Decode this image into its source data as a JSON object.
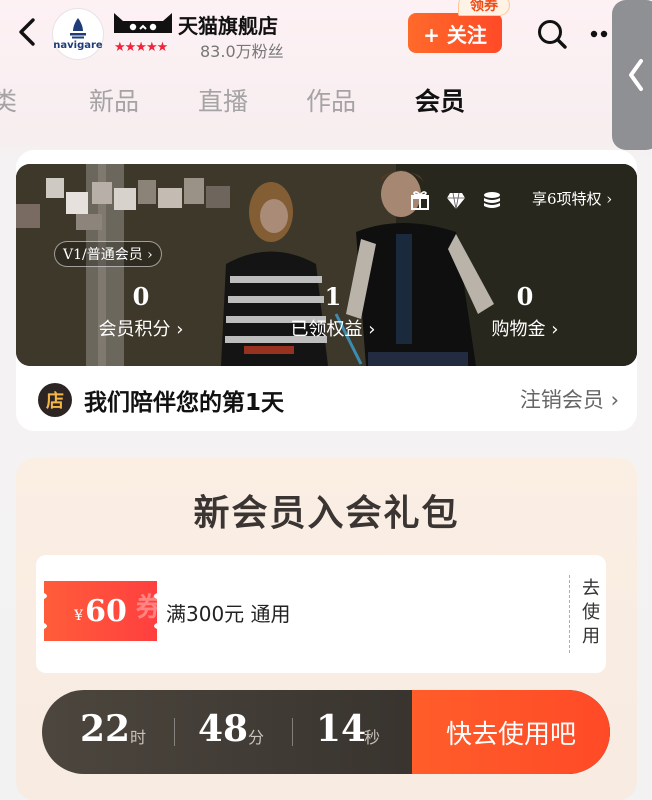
{
  "header": {
    "logo_text": "navigare",
    "store_name": "天猫旗舰店",
    "rating_stars": "★★★★★",
    "fans": "83.0万粉丝",
    "follow_label": "+ 关注",
    "coupon_tag": "领券",
    "colors": {
      "accent": "#ff4a27",
      "star": "#f0243a"
    }
  },
  "tabs": [
    {
      "label": "类",
      "active": false
    },
    {
      "label": "新品",
      "active": false
    },
    {
      "label": "直播",
      "active": false
    },
    {
      "label": "作品",
      "active": false
    },
    {
      "label": "会员",
      "active": true
    }
  ],
  "member": {
    "level": "V1/普通会员 ›",
    "perks_link": "享6项特权 ›",
    "perk_icons": [
      "gift-icon",
      "diamond-icon",
      "coins-icon"
    ],
    "stats": [
      {
        "value": "0",
        "label": "会员积分 ›"
      },
      {
        "value": "1",
        "label": "已领权益 ›"
      },
      {
        "value": "0",
        "label": "购物金 ›"
      }
    ],
    "store_badge": "店",
    "companion_text": "我们陪伴您的第1天",
    "cancel_label": "注销会员 ›"
  },
  "gift": {
    "title": "新会员入会礼包",
    "coupon": {
      "currency": "¥",
      "amount": "60",
      "watermark": "券",
      "description": "满300元 通用",
      "use_label": "去使用"
    },
    "countdown": {
      "hours": "22",
      "hours_unit": "时",
      "minutes": "48",
      "minutes_unit": "分",
      "seconds": "14",
      "seconds_unit": "秒",
      "cta": "快去使用吧"
    }
  }
}
